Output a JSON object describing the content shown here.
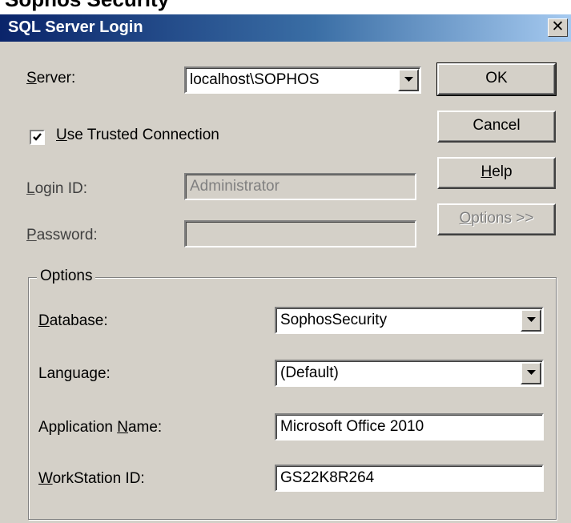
{
  "background_caption": "Sophos Security",
  "window": {
    "title": "SQL Server Login",
    "close_glyph": "✕"
  },
  "server": {
    "label": "Server:",
    "value": "localhost\\SOPHOS"
  },
  "trusted_connection": {
    "label": "Use Trusted Connection",
    "checked": true
  },
  "login_id": {
    "label": "Login ID:",
    "value": "Administrator"
  },
  "password": {
    "label": "Password:",
    "value": ""
  },
  "buttons": {
    "ok": "OK",
    "cancel": "Cancel",
    "help": "Help",
    "options": "Options >>"
  },
  "options_group": {
    "legend": "Options",
    "database": {
      "label": "Database:",
      "value": "SophosSecurity"
    },
    "language": {
      "label": "Language:",
      "value": "(Default)"
    },
    "application_name": {
      "label": "Application Name:",
      "value": "Microsoft Office 2010"
    },
    "workstation_id": {
      "label": "WorkStation ID:",
      "value": "GS22K8R264"
    }
  },
  "colors": {
    "dialog_face": "#d4d0c8",
    "title_start": "#0a246a",
    "title_end": "#a6caf0",
    "disabled_text": "#808080"
  }
}
